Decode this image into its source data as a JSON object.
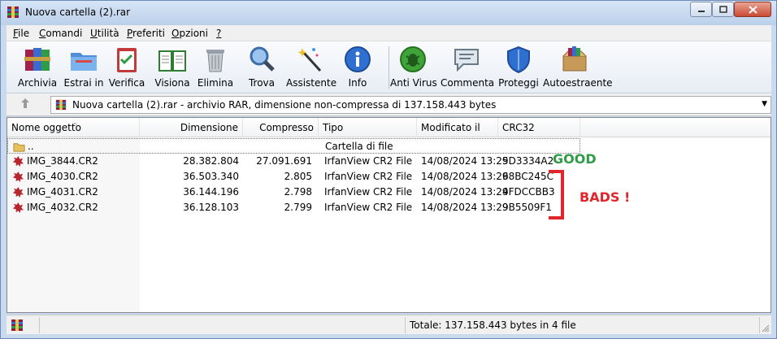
{
  "window": {
    "title": "Nuova cartella (2).rar"
  },
  "menu": [
    {
      "accel": "F",
      "rest": "ile"
    },
    {
      "accel": "C",
      "rest": "omandi"
    },
    {
      "accel": "U",
      "rest": "tilità"
    },
    {
      "accel": "P",
      "rest": "referiti"
    },
    {
      "accel": "O",
      "rest": "pzioni"
    },
    {
      "accel": "?",
      "rest": ""
    }
  ],
  "toolbar": [
    {
      "label": "Archivia",
      "icon": "archive-books-icon"
    },
    {
      "label": "Estrai in",
      "icon": "extract-folder-icon"
    },
    {
      "label": "Verifica",
      "icon": "test-clipboard-icon"
    },
    {
      "label": "Visiona",
      "icon": "view-book-icon"
    },
    {
      "label": "Elimina",
      "icon": "trash-icon"
    },
    {
      "label": "Trova",
      "icon": "magnifier-icon"
    },
    {
      "label": "Assistente",
      "icon": "wizard-wand-icon"
    },
    {
      "label": "Info",
      "icon": "info-icon"
    },
    {
      "label": "Anti Virus",
      "icon": "antivirus-bug-icon"
    },
    {
      "label": "Commenta",
      "icon": "comment-icon"
    },
    {
      "label": "Proteggi",
      "icon": "shield-icon"
    },
    {
      "label": "Autoestraente",
      "icon": "sfx-box-icon"
    }
  ],
  "address": {
    "text": "Nuova cartella (2).rar - archivio RAR, dimensione non-compressa di 137.158.443 bytes"
  },
  "columns": {
    "name": "Nome oggetto",
    "size": "Dimensione",
    "packed": "Compresso",
    "type": "Tipo",
    "modified": "Modificato il",
    "crc": "CRC32"
  },
  "rows": [
    {
      "name": "..",
      "size": "",
      "packed": "",
      "type": "Cartella di file",
      "modified": "",
      "crc": ""
    },
    {
      "name": "IMG_3844.CR2",
      "size": "28.382.804",
      "packed": "27.091.691",
      "type": "IrfanView CR2 File",
      "modified": "14/08/2024 13:29",
      "crc": "5D3334A2"
    },
    {
      "name": "IMG_4030.CR2",
      "size": "36.503.340",
      "packed": "2.805",
      "type": "IrfanView CR2 File",
      "modified": "14/08/2024 13:29",
      "crc": "68BC245C"
    },
    {
      "name": "IMG_4031.CR2",
      "size": "36.144.196",
      "packed": "2.798",
      "type": "IrfanView CR2 File",
      "modified": "14/08/2024 13:29",
      "crc": "4FDCCBB3"
    },
    {
      "name": "IMG_4032.CR2",
      "size": "36.128.103",
      "packed": "2.799",
      "type": "IrfanView CR2 File",
      "modified": "14/08/2024 13:29",
      "crc": "9B5509F1"
    }
  ],
  "annotations": {
    "good": "GOOD",
    "bads": "BADS !",
    "good_color": "#2e9b45",
    "bads_color": "#e0262a"
  },
  "status": {
    "total": "Totale: 137.158.443 bytes in 4 file"
  }
}
